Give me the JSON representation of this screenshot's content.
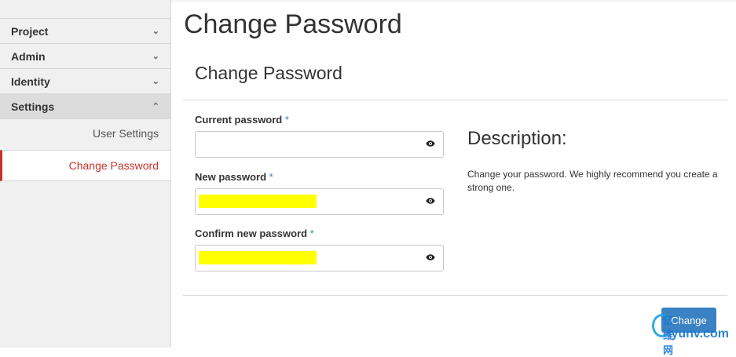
{
  "sidebar": {
    "items": [
      {
        "label": "Project",
        "chevron": "chevron-down-icon"
      },
      {
        "label": "Admin",
        "chevron": "chevron-down-icon"
      },
      {
        "label": "Identity",
        "chevron": "chevron-down-icon"
      },
      {
        "label": "Settings",
        "chevron": "chevron-up-icon"
      }
    ],
    "sub_items": [
      {
        "label": "User Settings"
      },
      {
        "label": "Change Password"
      }
    ],
    "active_color": "#c9322b"
  },
  "page": {
    "title": "Change Password"
  },
  "form": {
    "title": "Change Password",
    "required_mark": "*",
    "fields": [
      {
        "label": "Current password",
        "value": "",
        "icon": "eye-icon"
      },
      {
        "label": "New password",
        "value": "",
        "icon": "eye-icon",
        "highlight": "#ffff00"
      },
      {
        "label": "Confirm new password",
        "value": "",
        "icon": "eye-icon",
        "highlight": "#ffff00"
      }
    ],
    "submit_label": "Change",
    "accent": "#3a82c4"
  },
  "description": {
    "title": "Description:",
    "text": "Change your password. We highly recommend you create a strong one."
  },
  "watermark": {
    "text_top": "亿维网",
    "url": "iyunv.com"
  }
}
